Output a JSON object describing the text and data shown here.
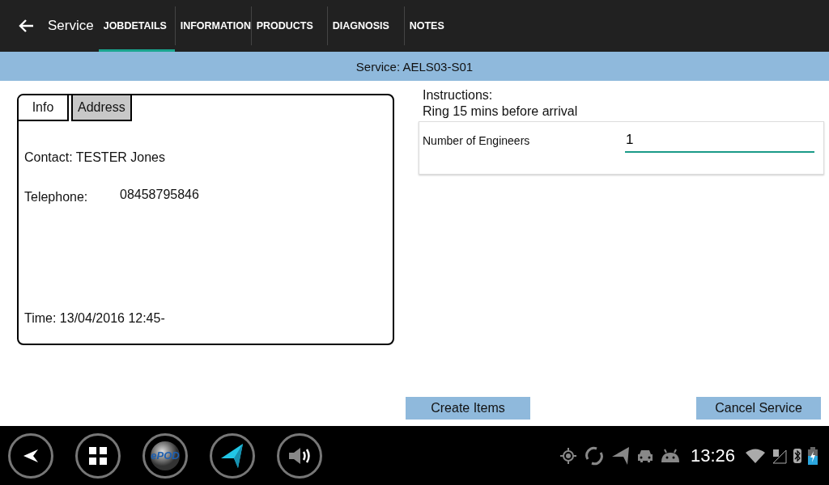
{
  "app_bar": {
    "title": "Service",
    "tabs": [
      {
        "label": "JOBDETAILS",
        "selected": true
      },
      {
        "label": "INFORMATION",
        "selected": false
      },
      {
        "label": "PRODUCTS",
        "selected": false
      },
      {
        "label": "DIAGNOSIS",
        "selected": false
      },
      {
        "label": "NOTES",
        "selected": false
      }
    ]
  },
  "header": {
    "title": "Service: AELS03-S01"
  },
  "info_card": {
    "tabs": [
      {
        "label": "Info",
        "selected": true
      },
      {
        "label": "Address",
        "selected": false
      }
    ],
    "contact": "Contact: TESTER Jones",
    "telephone_label": "Telephone:",
    "telephone": "08458795846",
    "time": "Time: 13/04/2016 12:45-"
  },
  "instructions": {
    "label": "Instructions:",
    "text": "Ring 15 mins before arrival"
  },
  "engineers_field": {
    "label": "Number of Engineers",
    "value": "1"
  },
  "buttons": [
    "Create Items",
    "Cancel Service"
  ],
  "dock": {
    "logo_text": "ePOD"
  },
  "status_bar": {
    "time": "13:26"
  }
}
